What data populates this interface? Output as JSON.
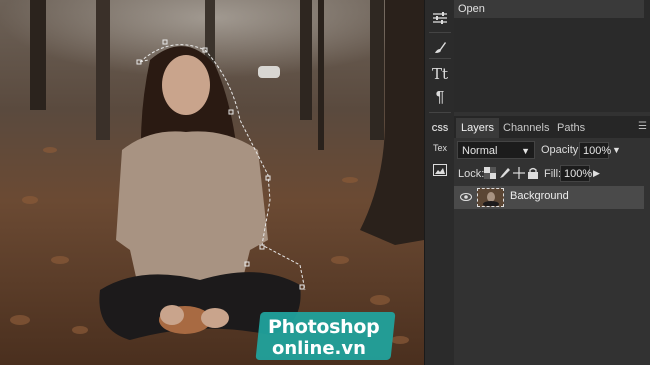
{
  "history": {
    "items": [
      "Open"
    ]
  },
  "toolbar": {
    "tools": [
      {
        "name": "adjustments-icon",
        "glyph": "☰"
      },
      {
        "name": "brush-icon",
        "glyph": "✎"
      },
      {
        "name": "text-tool-icon",
        "glyph": "Tt"
      },
      {
        "name": "paragraph-icon",
        "glyph": "¶"
      },
      {
        "name": "css-icon",
        "glyph": "CSS"
      },
      {
        "name": "text-info-icon",
        "glyph": "Tex"
      },
      {
        "name": "image-icon",
        "glyph": "▣"
      }
    ]
  },
  "layers_panel": {
    "tabs": [
      "Layers",
      "Channels",
      "Paths"
    ],
    "active_tab": "Layers",
    "blend_mode": "Normal",
    "opacity_label": "Opacity:",
    "opacity_value": "100%",
    "lock_label": "Lock:",
    "fill_label": "Fill:",
    "fill_value": "100%",
    "layers": [
      {
        "name": "Background"
      }
    ]
  },
  "watermark": {
    "line1": "Photoshop",
    "line2": "online.vn"
  },
  "colors": {
    "accent": "#1fa5a0",
    "panel": "#323232",
    "selected_layer": "#4a4a4a"
  }
}
